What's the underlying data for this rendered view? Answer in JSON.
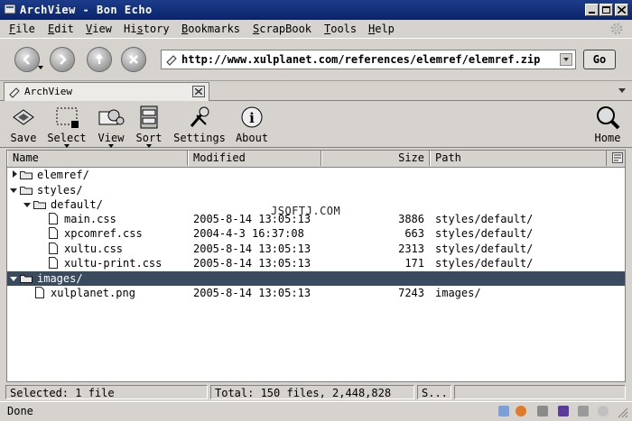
{
  "window": {
    "title": "ArchView - Bon Echo"
  },
  "menu": [
    {
      "label": "File",
      "u": "F"
    },
    {
      "label": "Edit",
      "u": "E"
    },
    {
      "label": "View",
      "u": "V"
    },
    {
      "label": "History",
      "u": "s"
    },
    {
      "label": "Bookmarks",
      "u": "B"
    },
    {
      "label": "ScrapBook",
      "u": "S"
    },
    {
      "label": "Tools",
      "u": "T"
    },
    {
      "label": "Help",
      "u": "H"
    }
  ],
  "nav": {
    "url": "http://www.xulplanet.com/references/elemref/elemref.zip",
    "go_label": "Go"
  },
  "tabs": [
    {
      "label": "ArchView"
    }
  ],
  "toolbar": {
    "save": "Save",
    "select": "Select",
    "view": "View",
    "sort": "Sort",
    "settings": "Settings",
    "about": "About",
    "home": "Home"
  },
  "columns": {
    "name": "Name",
    "modified": "Modified",
    "size": "Size",
    "path": "Path"
  },
  "rows": [
    {
      "name": "elemref/",
      "modified": "",
      "size": "",
      "path": ""
    },
    {
      "name": "styles/",
      "modified": "",
      "size": "",
      "path": ""
    },
    {
      "name": "default/",
      "modified": "",
      "size": "",
      "path": ""
    },
    {
      "name": "main.css",
      "modified": "2005-8-14 13:05:13",
      "size": "3886",
      "path": "styles/default/"
    },
    {
      "name": "xpcomref.css",
      "modified": "2004-4-3 16:37:08",
      "size": "663",
      "path": "styles/default/"
    },
    {
      "name": "xultu.css",
      "modified": "2005-8-14 13:05:13",
      "size": "2313",
      "path": "styles/default/"
    },
    {
      "name": "xultu-print.css",
      "modified": "2005-8-14 13:05:13",
      "size": "171",
      "path": "styles/default/"
    },
    {
      "name": "images/",
      "modified": "",
      "size": "",
      "path": ""
    },
    {
      "name": "xulplanet.png",
      "modified": "2005-8-14 13:05:13",
      "size": "7243",
      "path": "images/"
    }
  ],
  "overlay_text": "JSOFTJ.COM",
  "status": {
    "selected": "Selected: 1 file",
    "total": "Total: 150 files, 2,448,828",
    "s": "S...",
    "done": "Done"
  },
  "colors": {
    "title_bar": "#0a246a",
    "selection": "#3a4a5f",
    "chrome": "#d6d3ce"
  }
}
